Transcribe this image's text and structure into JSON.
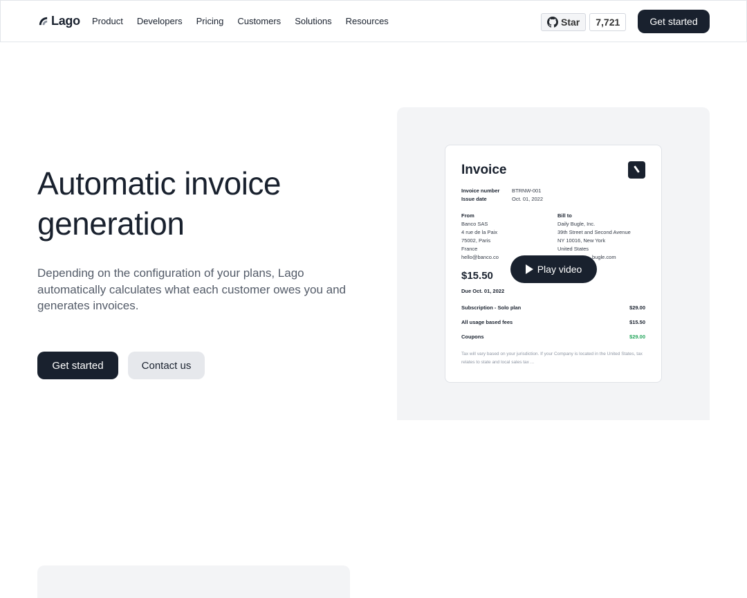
{
  "nav": {
    "logo": "Lago",
    "links": [
      "Product",
      "Developers",
      "Pricing",
      "Customers",
      "Solutions",
      "Resources"
    ],
    "github_star": "Star",
    "github_count": "7,721",
    "cta": "Get started"
  },
  "hero": {
    "title": "Automatic invoice generation",
    "description": "Depending on the configuration of your plans, Lago automatically calculates what each customer owes you and generates invoices.",
    "primary_button": "Get started",
    "secondary_button": "Contact us"
  },
  "invoice": {
    "title": "Invoice",
    "number_label": "Invoice number",
    "number_value": "BTRNW-001",
    "date_label": "Issue date",
    "date_value": "Oct. 01, 2022",
    "from_label": "From",
    "from_lines": [
      "Banco SAS",
      "4 rue de la Paix",
      "75002, Paris",
      "France",
      "hello@banco.co"
    ],
    "bill_label": "Bill to",
    "bill_lines": [
      "Daily Bugle, Inc.",
      "39th Street and Second Avenue",
      "NY 10016, New York",
      "United States",
      "bugle.com"
    ],
    "amount": "$15.50",
    "due": "Due Oct. 01, 2022",
    "rows": [
      {
        "label": "Subscription - Solo plan",
        "value": "$29.00"
      },
      {
        "label": "All usage based fees",
        "value": "$15.50"
      },
      {
        "label": "Coupons",
        "value": "$29.00"
      }
    ],
    "note": "Tax will vary based on your jurisdiction. If your Company is located in the United States, tax relates to state and local sales tax ...",
    "play_label": "Play video"
  },
  "colors": {
    "primary": "#19212e",
    "panel": "#f3f4f6",
    "coupon_green": "#22a55a"
  }
}
